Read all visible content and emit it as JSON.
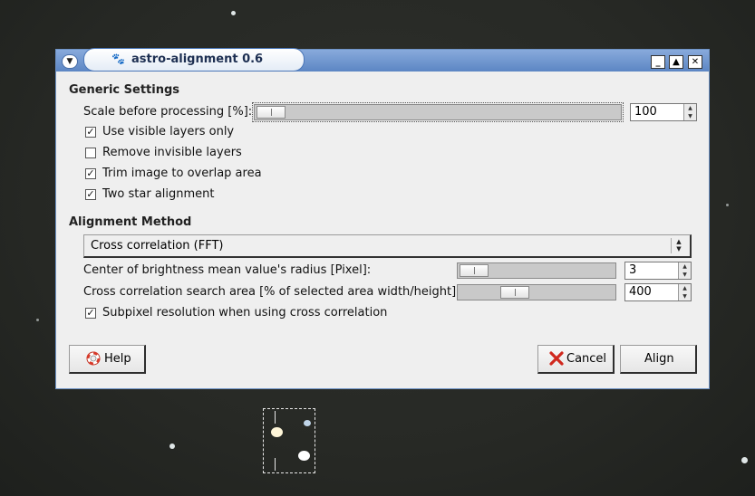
{
  "window": {
    "title": "astro-alignment 0.6",
    "controls": [
      "minimize-icon",
      "maximize-icon",
      "close-icon"
    ]
  },
  "generic": {
    "heading": "Generic Settings",
    "scale_label": "Scale before processing [%]:",
    "scale_value": "100",
    "scale_level": 0.0,
    "checks": [
      {
        "label": "Use visible layers only",
        "checked": true
      },
      {
        "label": "Remove invisible layers",
        "checked": false
      },
      {
        "label": "Trim image to overlap area",
        "checked": true
      },
      {
        "label": "Two star alignment",
        "checked": true
      }
    ]
  },
  "alignment": {
    "heading": "Alignment Method",
    "method": "Cross correlation (FFT)",
    "radius_label": "Center of brightness mean value's radius [Pixel]:",
    "radius_value": "3",
    "search_label": "Cross correlation search area [% of selected area width/height]:",
    "search_value": "400",
    "subpixel_label": "Subpixel resolution when using cross correlation",
    "subpixel_checked": true
  },
  "buttons": {
    "help": "Help",
    "cancel": "Cancel",
    "align": "Align"
  },
  "colors": {
    "titlebar": "#6f95cf",
    "dialog_bg": "#efefef",
    "background_sky": "#2a2c28"
  }
}
